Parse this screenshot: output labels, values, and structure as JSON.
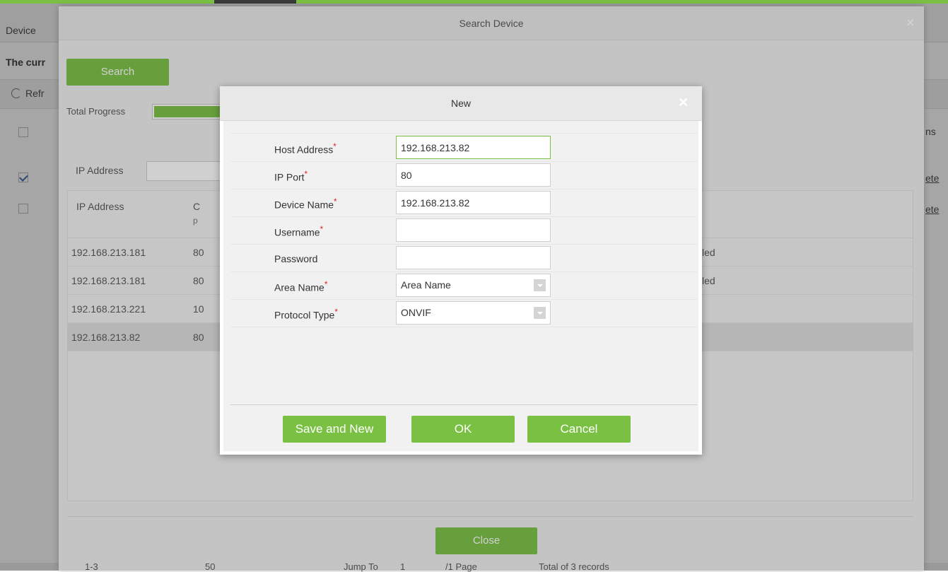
{
  "background": {
    "tab_label": "Device",
    "current_text": "The curr",
    "refresh_label": "Refr",
    "right_header": "ns",
    "right_link_1": "ete",
    "right_link_2": "ete"
  },
  "search_device": {
    "title": "Search Device",
    "search_button": "Search",
    "progress_label": "Total Progress",
    "progress_fraction": 1.0,
    "ip_filter_label": "IP Address",
    "columns": {
      "ip_address": "IP Address",
      "port_partial": "C",
      "port_partial_sub": "p"
    },
    "rows": [
      {
        "ip": "192.168.213.181",
        "port": "80",
        "status": "led"
      },
      {
        "ip": "192.168.213.181",
        "port": "80",
        "status": "led"
      },
      {
        "ip": "192.168.213.221",
        "port": "10",
        "status": ""
      },
      {
        "ip": "192.168.213.82",
        "port": "80",
        "status": ""
      }
    ],
    "close_button": "Close",
    "footer": {
      "pages": "1-3",
      "per_page": "50",
      "jump_to": "Jump To",
      "jump_value": "1",
      "page_info": "/1 Page",
      "total": "Total of 3 records"
    }
  },
  "new_dialog": {
    "title": "New",
    "fields": {
      "host_address": {
        "label": "Host Address",
        "value": "192.168.213.82"
      },
      "ip_port": {
        "label": "IP Port",
        "value": "80"
      },
      "device_name": {
        "label": "Device Name",
        "value": "192.168.213.82"
      },
      "username": {
        "label": "Username",
        "value": ""
      },
      "password": {
        "label": "Password",
        "value": ""
      },
      "area_name": {
        "label": "Area Name",
        "value": "Area Name"
      },
      "protocol_type": {
        "label": "Protocol Type",
        "value": "ONVIF"
      }
    },
    "required_mark": "*",
    "buttons": {
      "save_and_new": "Save and New",
      "ok": "OK",
      "cancel": "Cancel"
    }
  },
  "colors": {
    "accent_green": "#7ac143",
    "required_red": "#e02020"
  }
}
